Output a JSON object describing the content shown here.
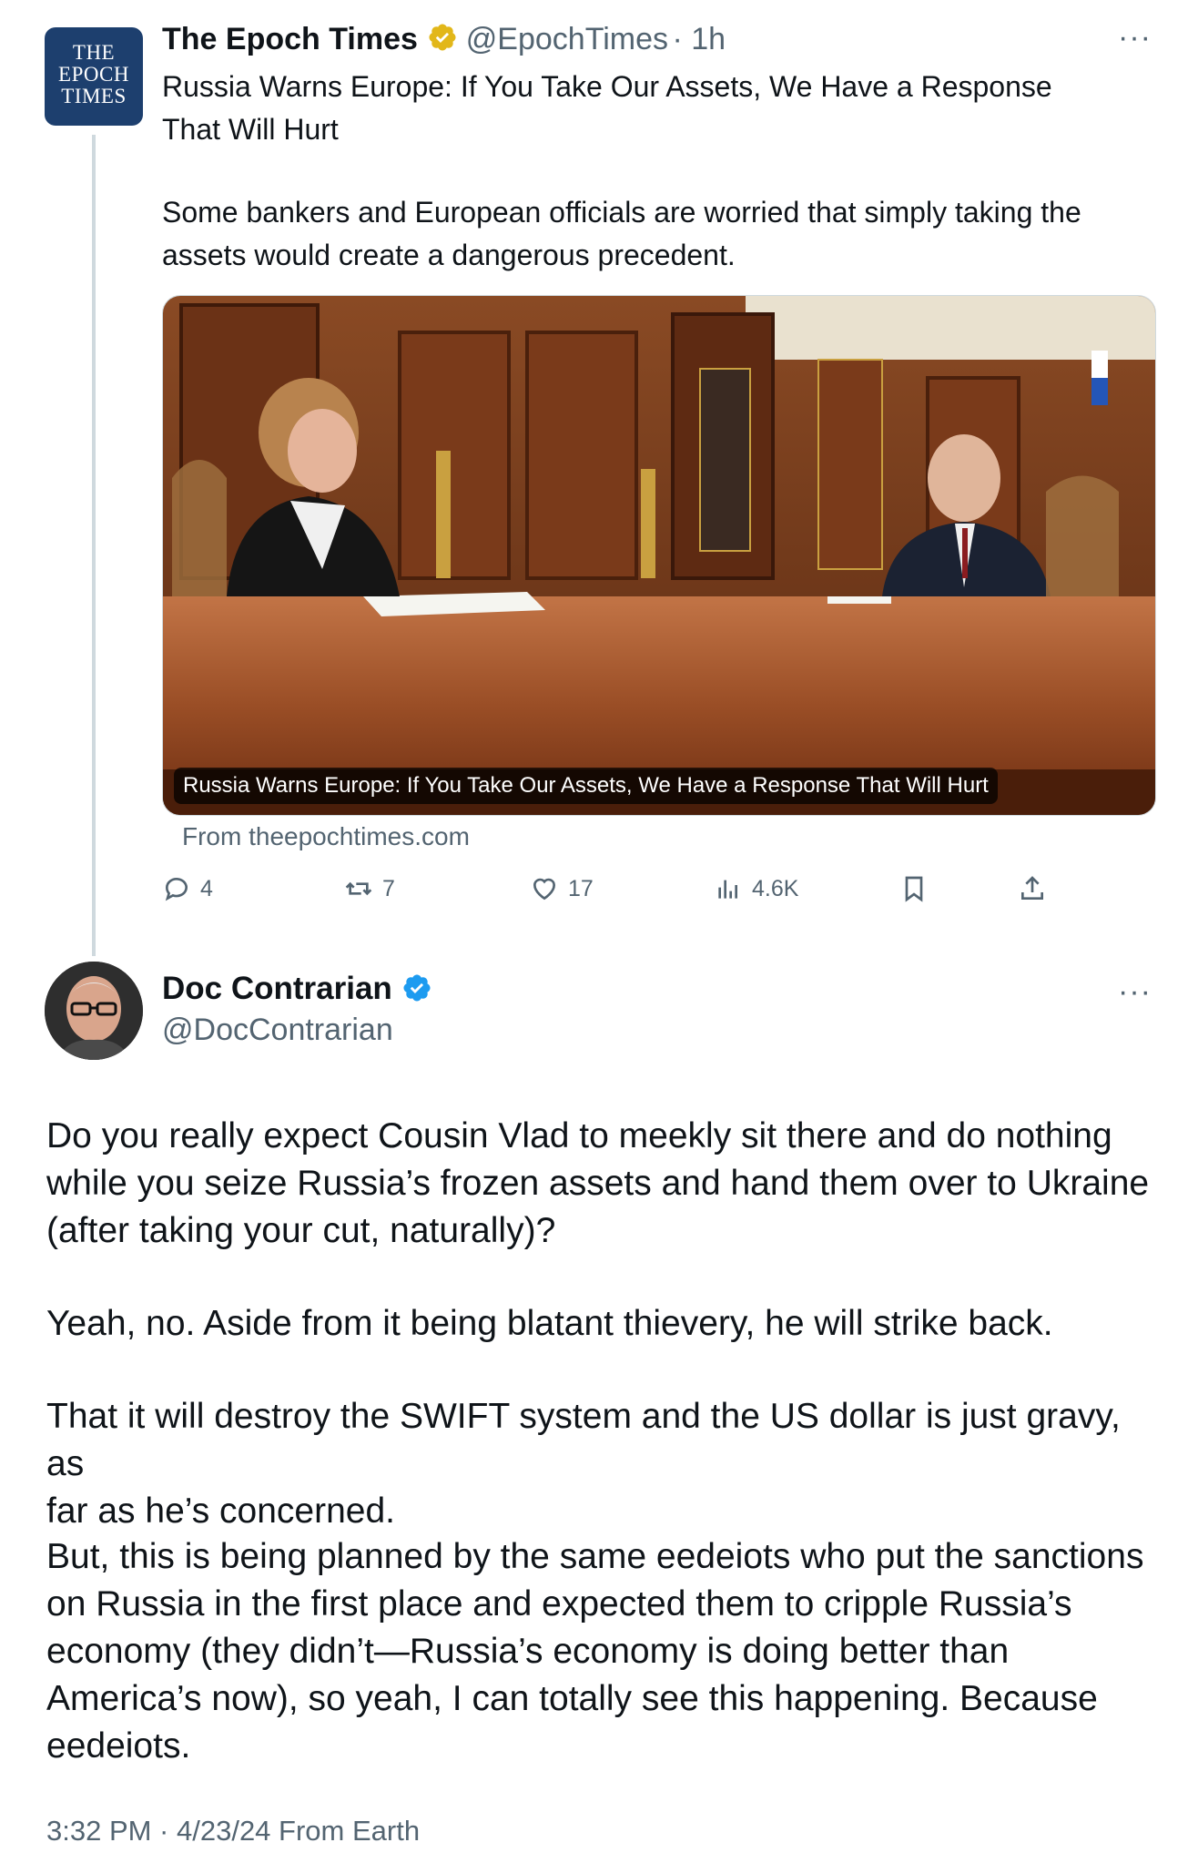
{
  "quoted_tweet": {
    "avatar_logo": [
      "THE",
      "EPOCH",
      "TIMES"
    ],
    "name": "The Epoch Times",
    "verified_badge": "gold-verified-icon",
    "handle": "@EpochTimes",
    "time": "· 1h",
    "more": "···",
    "headline_line1": "Russia Warns Europe: If You Take Our Assets, We Have a Response",
    "headline_line2": "That Will Hurt",
    "summary_line1": "Some bankers and European officials are worried that simply taking the",
    "summary_line2": "assets would create a dangerous precedent.",
    "media_caption": "Russia Warns Europe: If You Take Our Assets, We Have a Response That Will Hurt",
    "source": "From theepochtimes.com",
    "actions": {
      "replies": "4",
      "reposts": "7",
      "likes": "17",
      "views": "4.6K"
    }
  },
  "main_tweet": {
    "name": "Doc Contrarian",
    "verified_badge": "blue-verified-icon",
    "handle": "@DocContrarian",
    "more": "···",
    "paragraphs": [
      [
        "Do you really expect Cousin Vlad to meekly sit there and do nothing",
        "while you seize Russia’s frozen assets and hand them over to Ukraine",
        "(after taking your cut, naturally)?"
      ],
      [
        "Yeah, no. Aside from it being blatant thievery, he will strike back."
      ],
      [
        "That it will destroy the SWIFT system and the US dollar is just gravy, as",
        "far as he’s concerned."
      ],
      [
        "But, this is being planned by the same eedeiots who put the sanctions",
        "on Russia in the first place and expected them to cripple Russia’s",
        "economy (they didn’t—Russia’s economy is doing better than",
        "America’s now), so yeah, I can totally see this happening. Because",
        "eedeiots."
      ]
    ],
    "timestamp": "3:32 PM · 4/23/24 From Earth"
  },
  "colors": {
    "text": "#0f1419",
    "secondary": "#536471",
    "blue_check": "#1d9bf0",
    "gold_check": "#e2b719",
    "epoch_navy": "#1d3f6e"
  }
}
